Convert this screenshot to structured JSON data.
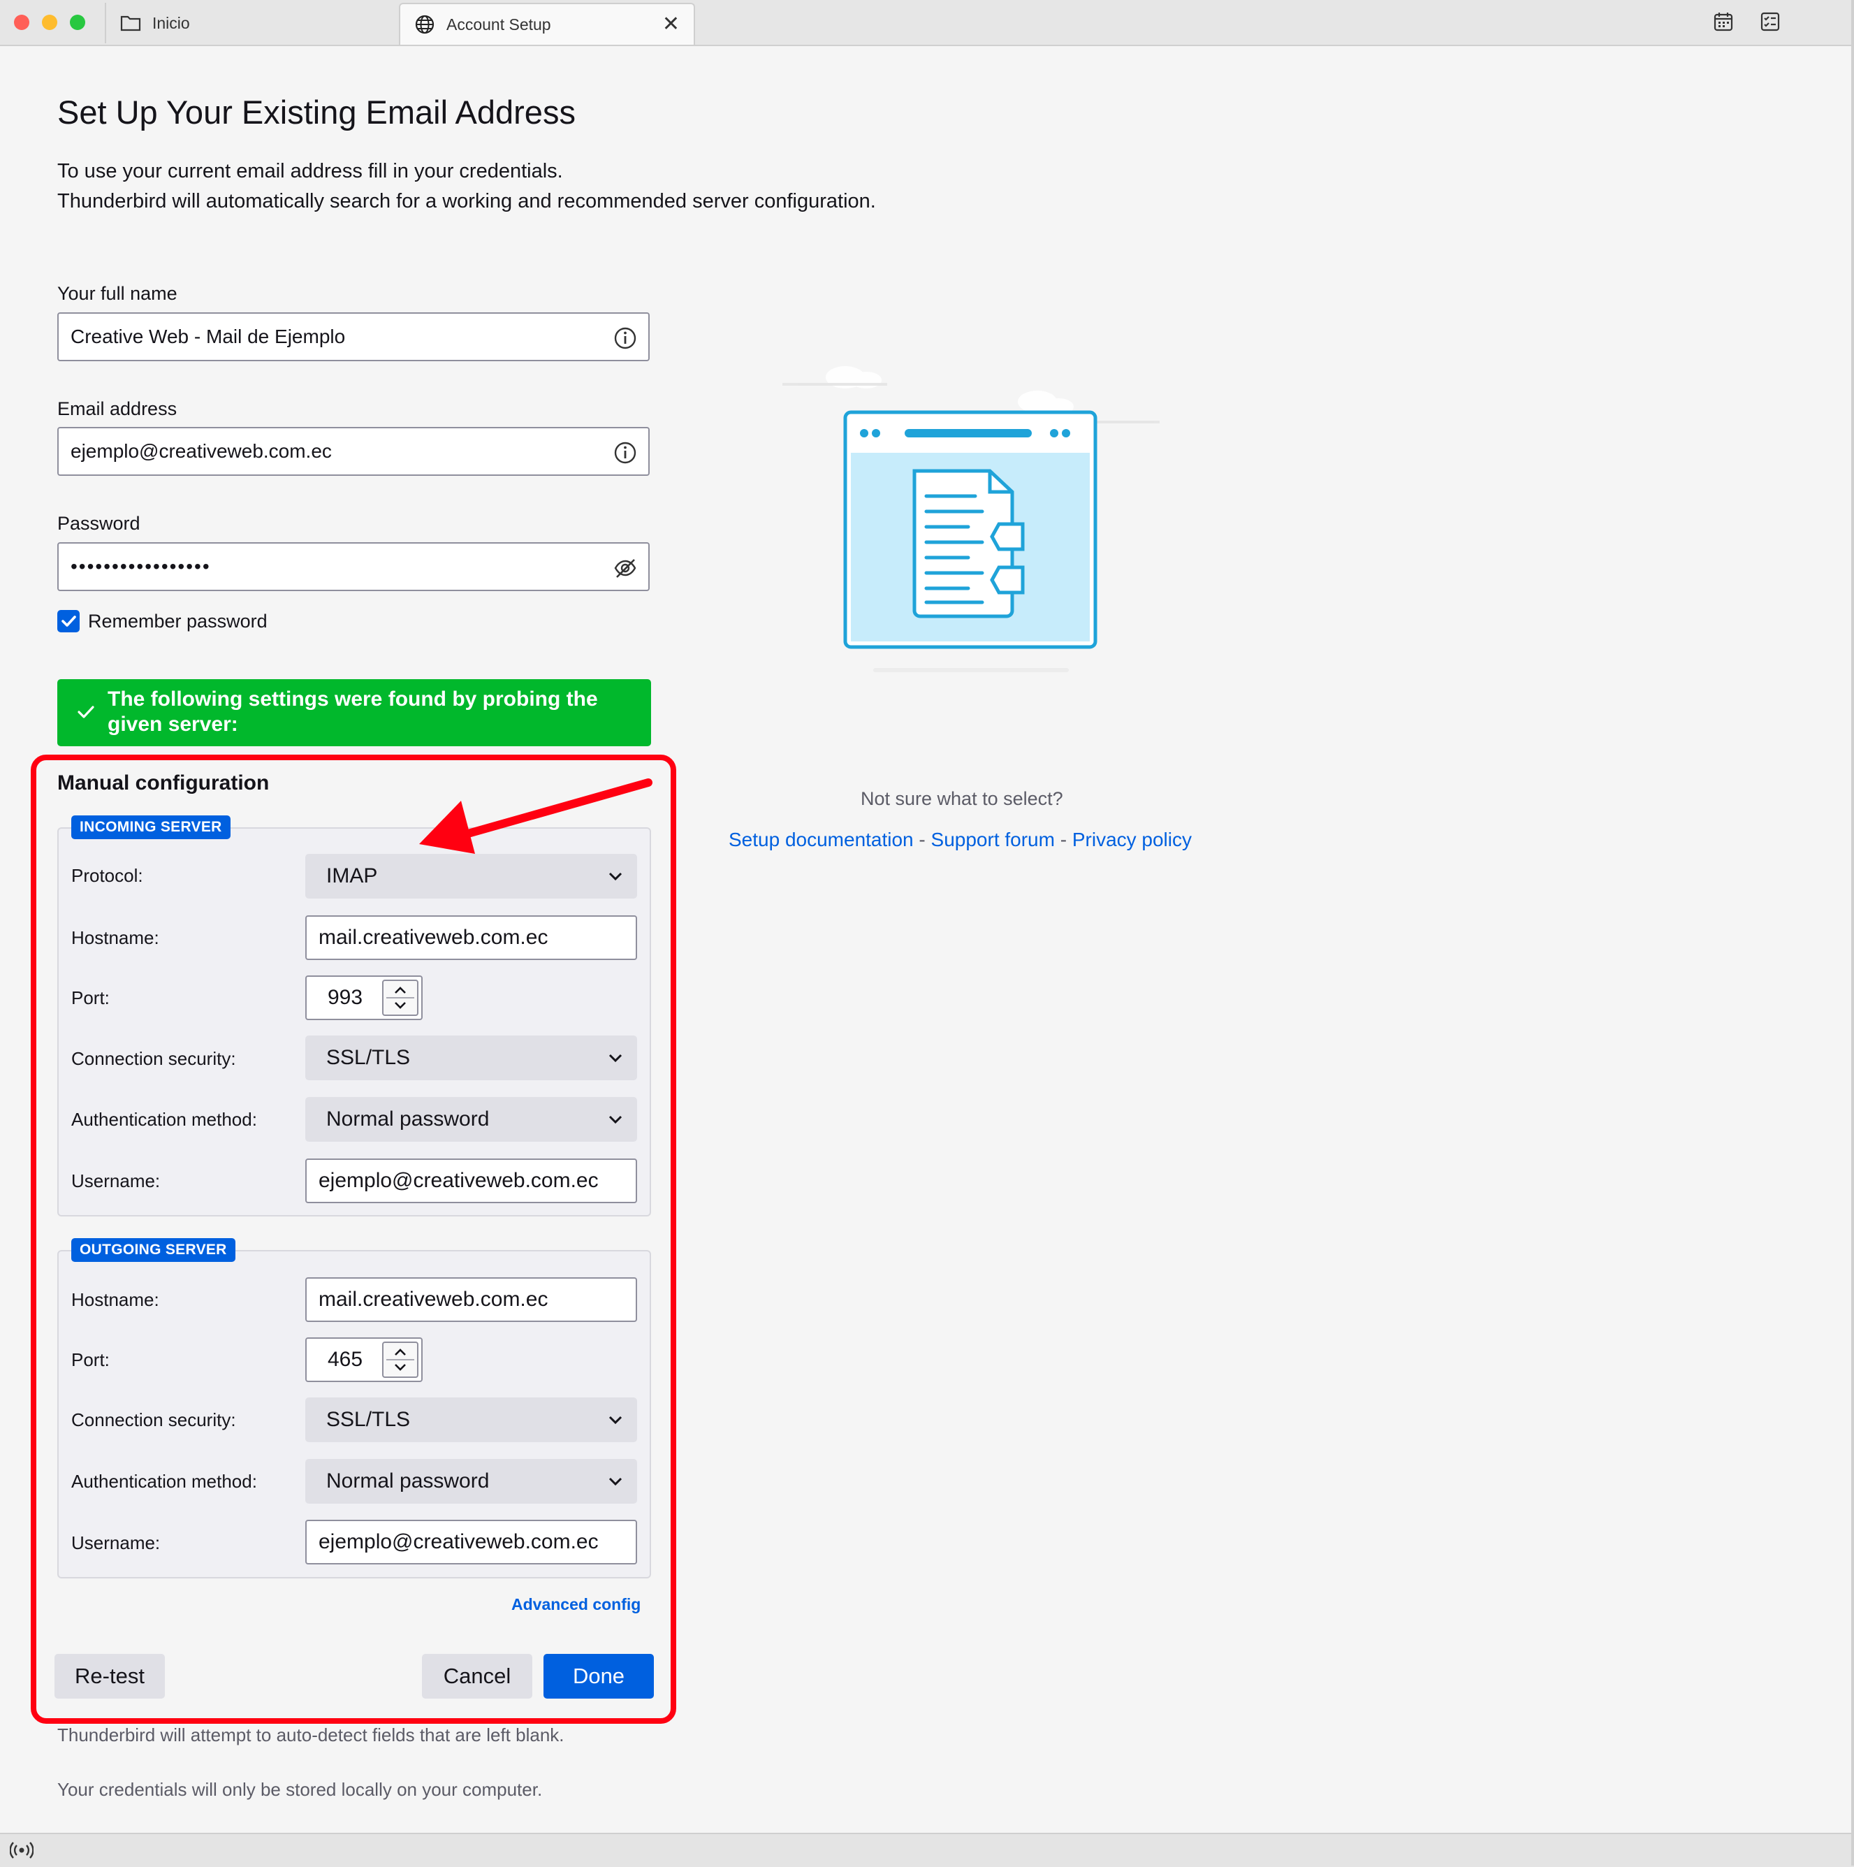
{
  "window": {
    "tabs": [
      {
        "label": "Inicio",
        "icon": "folder-icon"
      },
      {
        "label": "Account Setup",
        "icon": "globe-icon",
        "active": true
      }
    ],
    "toolbar_icons": [
      "calendar-icon",
      "tasks-icon"
    ]
  },
  "page": {
    "title": "Set Up Your Existing Email Address",
    "intro_line1": "To use your current email address fill in your credentials.",
    "intro_line2": "Thunderbird will automatically search for a working and recommended server configuration."
  },
  "form": {
    "full_name_label": "Your full name",
    "full_name_value": "Creative Web - Mail de Ejemplo",
    "email_label": "Email address",
    "email_value": "ejemplo@creativeweb.com.ec",
    "password_label": "Password",
    "password_value": "•••••••••••••••••",
    "remember_label": "Remember password",
    "remember_checked": true
  },
  "success_message": "The following settings were found by probing the given server:",
  "manual": {
    "title": "Manual configuration",
    "incoming": {
      "legend": "INCOMING SERVER",
      "protocol_label": "Protocol:",
      "protocol_value": "IMAP",
      "hostname_label": "Hostname:",
      "hostname_value": "mail.creativeweb.com.ec",
      "port_label": "Port:",
      "port_value": "993",
      "security_label": "Connection security:",
      "security_value": "SSL/TLS",
      "auth_label": "Authentication method:",
      "auth_value": "Normal password",
      "username_label": "Username:",
      "username_value": "ejemplo@creativeweb.com.ec"
    },
    "outgoing": {
      "legend": "OUTGOING SERVER",
      "hostname_label": "Hostname:",
      "hostname_value": "mail.creativeweb.com.ec",
      "port_label": "Port:",
      "port_value": "465",
      "security_label": "Connection security:",
      "security_value": "SSL/TLS",
      "auth_label": "Authentication method:",
      "auth_value": "Normal password",
      "username_label": "Username:",
      "username_value": "ejemplo@creativeweb.com.ec"
    },
    "advanced_link": "Advanced config",
    "retest_label": "Re-test",
    "cancel_label": "Cancel",
    "done_label": "Done"
  },
  "notes": {
    "autodetect": "Thunderbird will attempt to auto-detect fields that are left blank.",
    "credentials": "Your credentials will only be stored locally on your computer."
  },
  "help": {
    "question": "Not sure what to select?",
    "links": [
      "Setup documentation",
      "Support forum",
      "Privacy policy"
    ],
    "separator": " - "
  },
  "colors": {
    "accent": "#0060df",
    "success": "#01b82c",
    "annotation": "#ff0011"
  }
}
